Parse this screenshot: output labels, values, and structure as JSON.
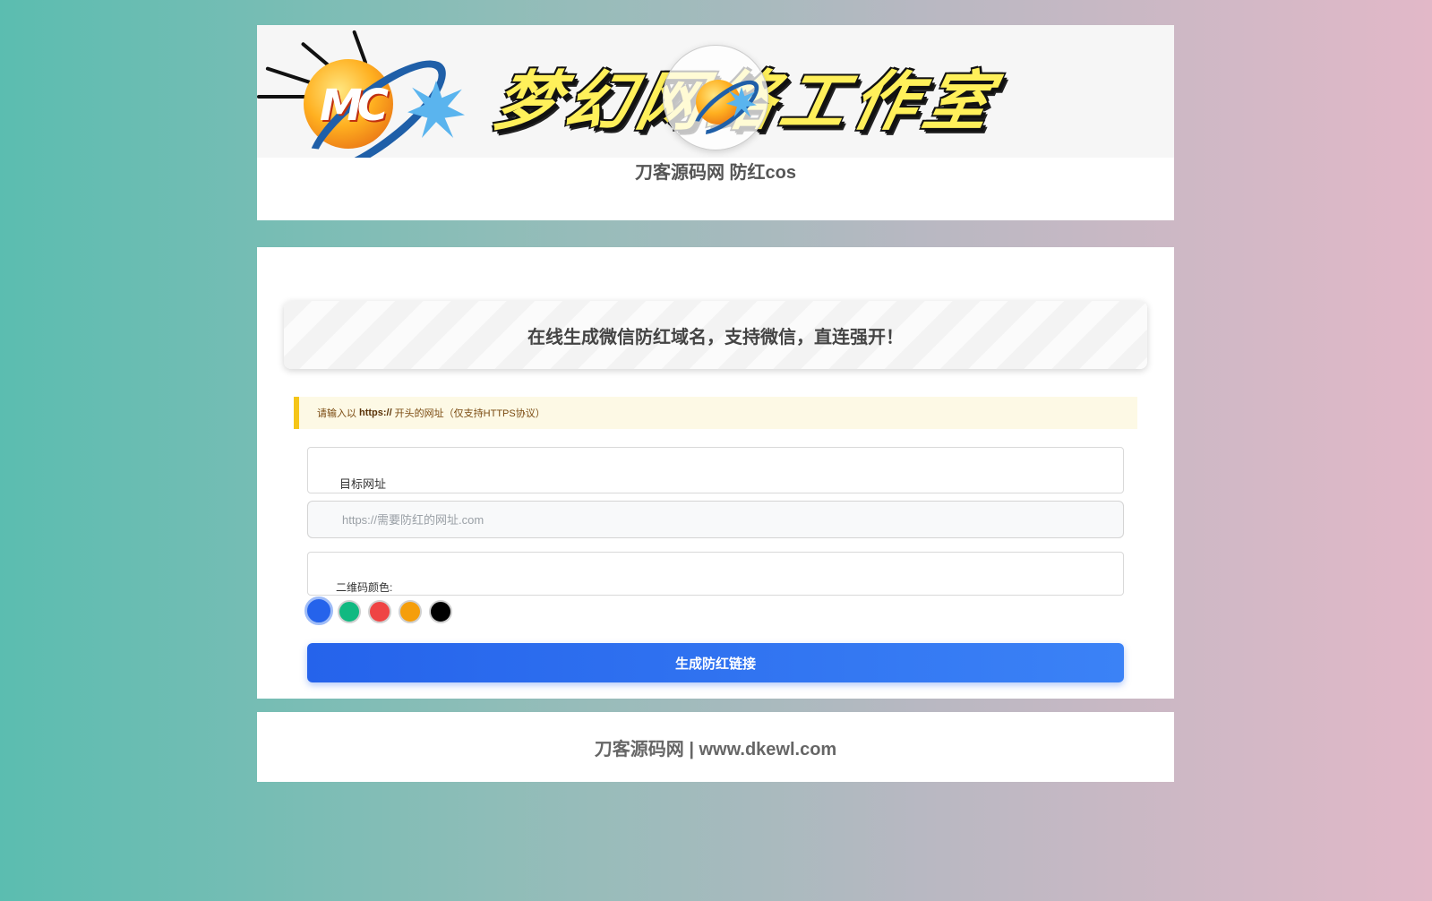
{
  "header": {
    "banner_title": "梦幻网络工作室",
    "logo_letters": "MC",
    "site_name": "刀客源码网 防红cos"
  },
  "main": {
    "hero_text": "在线生成微信防红域名，支持微信，直连强开！",
    "notice": {
      "prefix": "请输入以",
      "bold": "https://",
      "suffix": "开头的网址（仅支持HTTPS协议）"
    },
    "url_field": {
      "label": "目标网址",
      "value": "",
      "placeholder": "https://需要防红的网址.com"
    },
    "color_field": {
      "label": "二维码颜色:",
      "options": [
        {
          "name": "blue",
          "hex": "#2563eb",
          "selected": true
        },
        {
          "name": "green",
          "hex": "#10b981",
          "selected": false
        },
        {
          "name": "red",
          "hex": "#ef4444",
          "selected": false
        },
        {
          "name": "orange",
          "hex": "#f59e0b",
          "selected": false
        },
        {
          "name": "black",
          "hex": "#000000",
          "selected": false
        }
      ]
    },
    "generate_button": "生成防红链接"
  },
  "footer": {
    "text": "刀客源码网 | www.dkewl.com"
  }
}
